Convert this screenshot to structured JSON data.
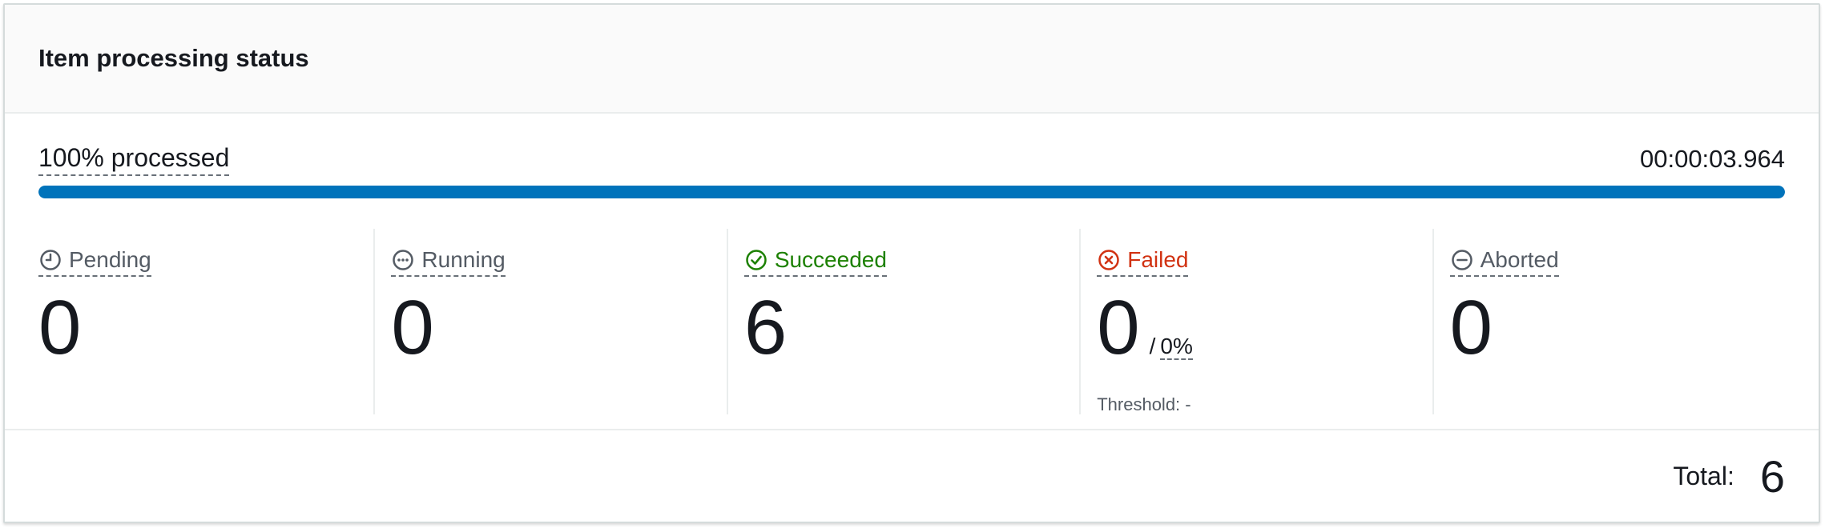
{
  "panel": {
    "title": "Item processing status"
  },
  "progress": {
    "label": "100% processed",
    "elapsed": "00:00:03.964",
    "fraction": 1.0,
    "color": "#0073bb"
  },
  "stats": [
    {
      "key": "pending",
      "label": "Pending",
      "value": "0",
      "icon": "clock-icon",
      "color": "#545b64"
    },
    {
      "key": "running",
      "label": "Running",
      "value": "0",
      "icon": "more-dots-icon",
      "color": "#545b64"
    },
    {
      "key": "succeeded",
      "label": "Succeeded",
      "value": "6",
      "icon": "check-circle-icon",
      "color": "#1d8102"
    },
    {
      "key": "failed",
      "label": "Failed",
      "value": "0",
      "icon": "x-circle-icon",
      "color": "#d13212",
      "rate_sep": "/",
      "rate": "0%",
      "threshold": "Threshold: -"
    },
    {
      "key": "aborted",
      "label": "Aborted",
      "value": "0",
      "icon": "minus-circle-icon",
      "color": "#545b64"
    }
  ],
  "footer": {
    "total_label": "Total:",
    "total_value": "6"
  }
}
